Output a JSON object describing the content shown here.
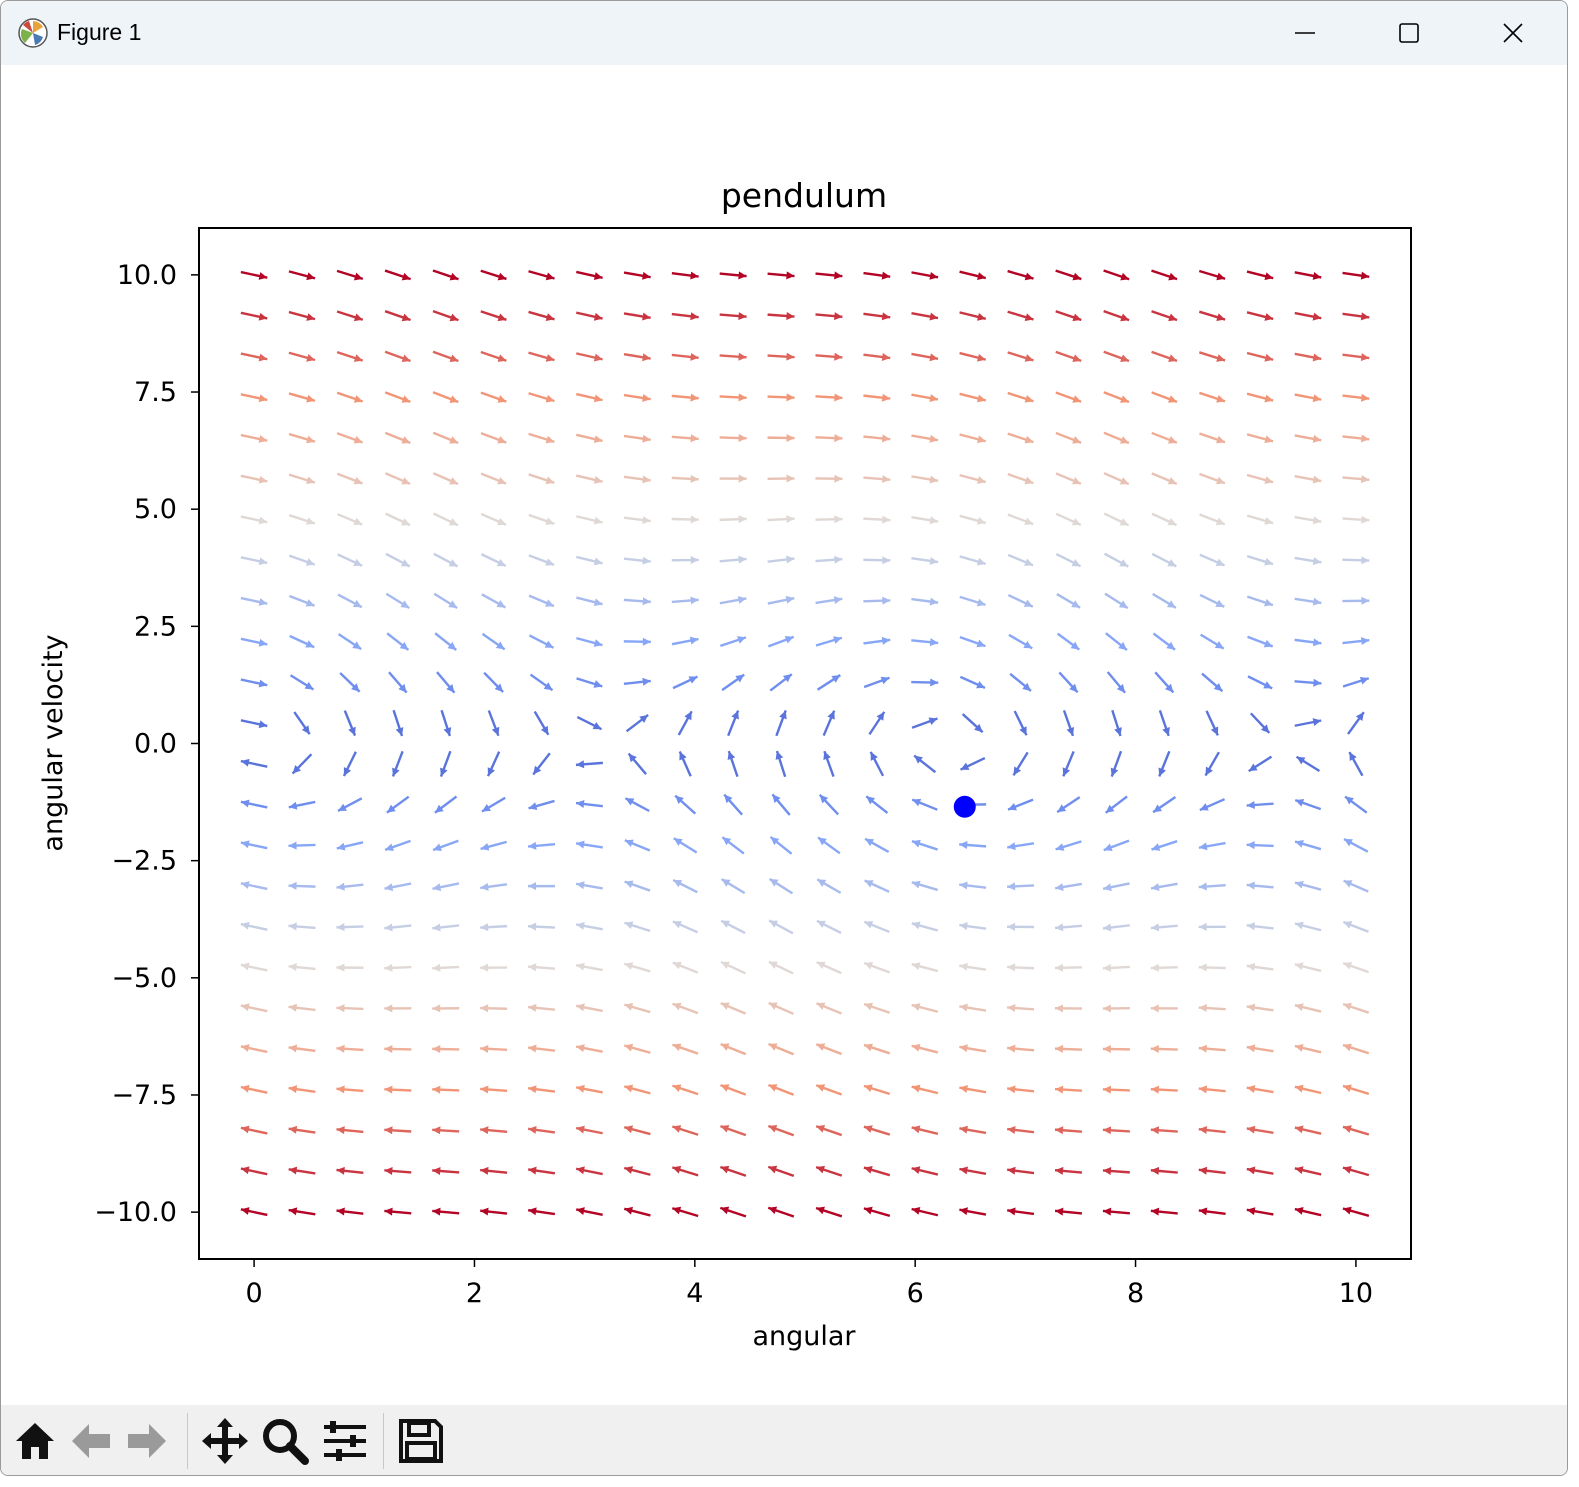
{
  "window": {
    "title": "Figure 1"
  },
  "toolbar": {
    "items": [
      "home-icon",
      "back-icon",
      "forward-icon",
      "pan-icon",
      "zoom-icon",
      "configure-subplots-icon",
      "save-icon"
    ]
  },
  "chart_data": {
    "type": "quiver",
    "title": "pendulum",
    "xlabel": "angular",
    "ylabel": "angular velocity",
    "xlim": [
      -0.5,
      10.5
    ],
    "ylim": [
      -11,
      11
    ],
    "xticks": [
      0,
      2,
      4,
      6,
      8,
      10
    ],
    "xtick_labels": [
      "0",
      "2",
      "4",
      "6",
      "8",
      "10"
    ],
    "yticks": [
      10.0,
      7.5,
      5.0,
      2.5,
      0.0,
      -2.5,
      -5.0,
      -7.5,
      -10.0
    ],
    "ytick_labels": [
      "10.0",
      "7.5",
      "5.0",
      "2.5",
      "0.0",
      "−2.5",
      "−5.0",
      "−7.5",
      "−10.0"
    ],
    "grid": false,
    "field": {
      "x_range": [
        0,
        10
      ],
      "x_count": 24,
      "y_range": [
        -10,
        10
      ],
      "y_count": 24,
      "u": "y",
      "v": "-3*sin(x) - 0.5*y",
      "colormap": "coolwarm",
      "color_by": "|y|"
    },
    "marker": {
      "x": 6.45,
      "y": -1.35,
      "color": "#0000ff"
    }
  }
}
